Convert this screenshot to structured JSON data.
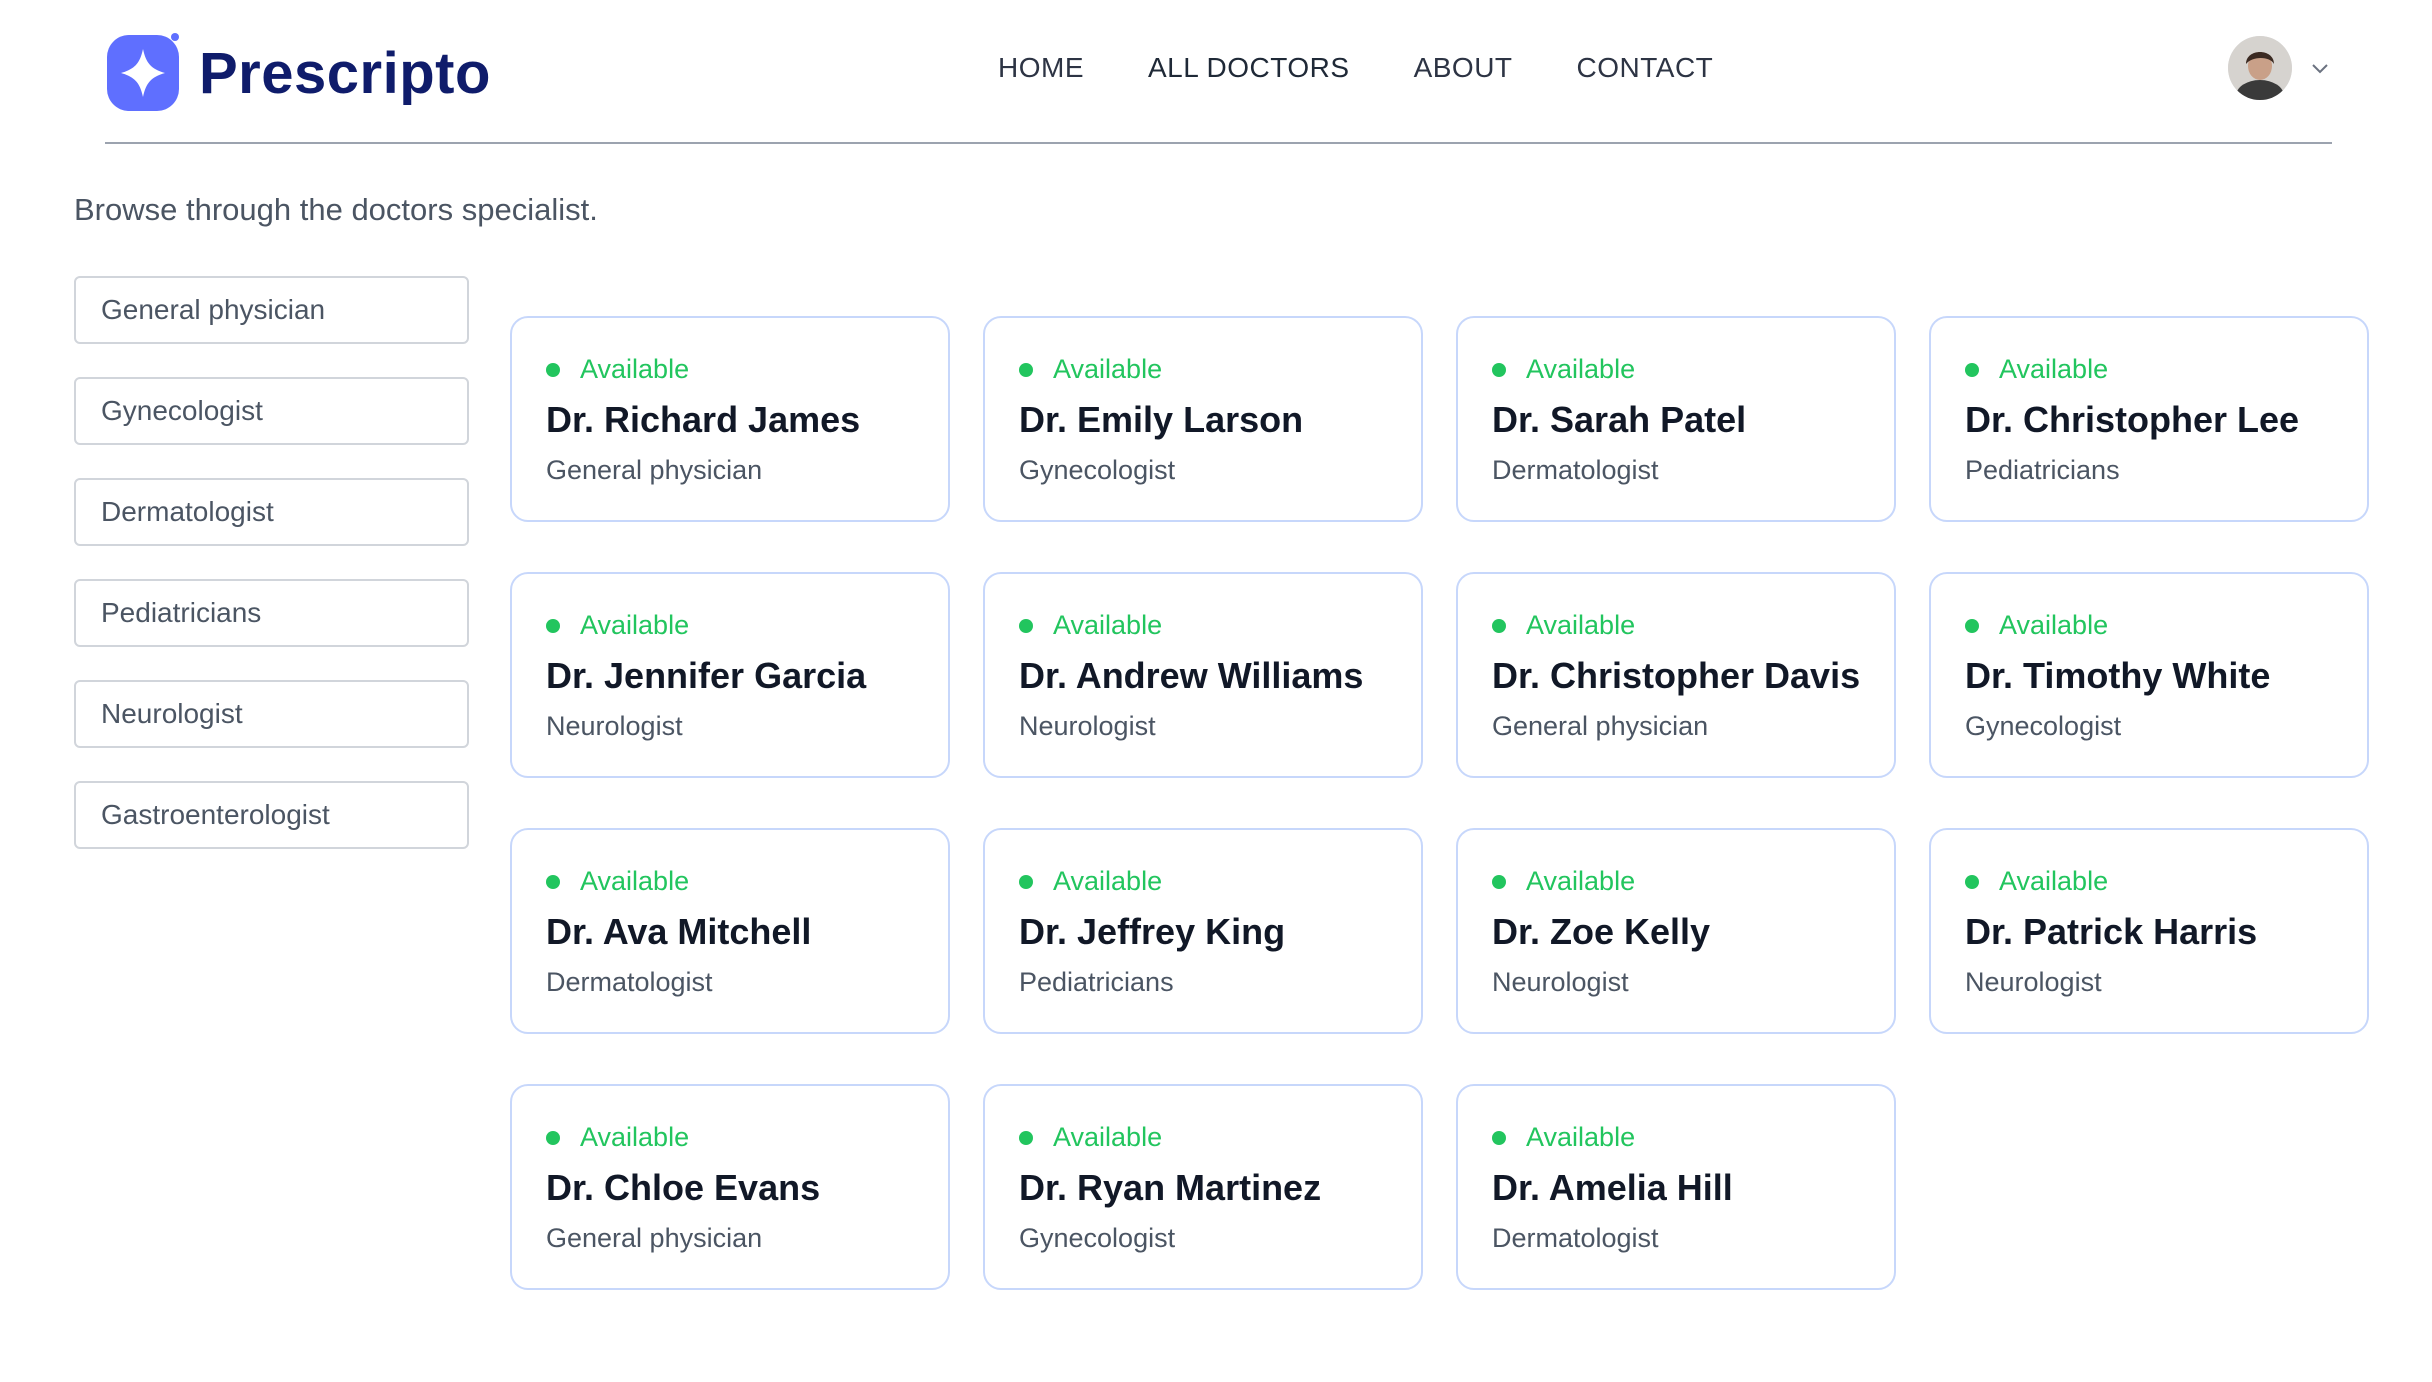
{
  "brand": {
    "name": "Prescripto",
    "accent": "#5f6fff",
    "dark": "#0f1c6b"
  },
  "nav": [
    "HOME",
    "ALL DOCTORS",
    "ABOUT",
    "CONTACT"
  ],
  "subtitle": "Browse through the doctors specialist.",
  "specialities": [
    "General physician",
    "Gynecologist",
    "Dermatologist",
    "Pediatricians",
    "Neurologist",
    "Gastroenterologist"
  ],
  "status_color": "#22c55e",
  "doctors": [
    {
      "status": "Available",
      "name": "Dr. Richard James",
      "speciality": "General physician"
    },
    {
      "status": "Available",
      "name": "Dr. Emily Larson",
      "speciality": "Gynecologist"
    },
    {
      "status": "Available",
      "name": "Dr. Sarah Patel",
      "speciality": "Dermatologist"
    },
    {
      "status": "Available",
      "name": "Dr. Christopher Lee",
      "speciality": "Pediatricians"
    },
    {
      "status": "Available",
      "name": "Dr. Jennifer Garcia",
      "speciality": "Neurologist"
    },
    {
      "status": "Available",
      "name": "Dr. Andrew Williams",
      "speciality": "Neurologist"
    },
    {
      "status": "Available",
      "name": "Dr. Christopher Davis",
      "speciality": "General physician"
    },
    {
      "status": "Available",
      "name": "Dr. Timothy White",
      "speciality": "Gynecologist"
    },
    {
      "status": "Available",
      "name": "Dr. Ava Mitchell",
      "speciality": "Dermatologist"
    },
    {
      "status": "Available",
      "name": "Dr. Jeffrey King",
      "speciality": "Pediatricians"
    },
    {
      "status": "Available",
      "name": "Dr. Zoe Kelly",
      "speciality": "Neurologist"
    },
    {
      "status": "Available",
      "name": "Dr. Patrick Harris",
      "speciality": "Neurologist"
    },
    {
      "status": "Available",
      "name": "Dr. Chloe Evans",
      "speciality": "General physician"
    },
    {
      "status": "Available",
      "name": "Dr. Ryan Martinez",
      "speciality": "Gynecologist"
    },
    {
      "status": "Available",
      "name": "Dr. Amelia Hill",
      "speciality": "Dermatologist"
    }
  ],
  "icons": {
    "logo": "logo-icon",
    "avatar": "avatar-image",
    "dropdown": "chevron-down-icon"
  }
}
